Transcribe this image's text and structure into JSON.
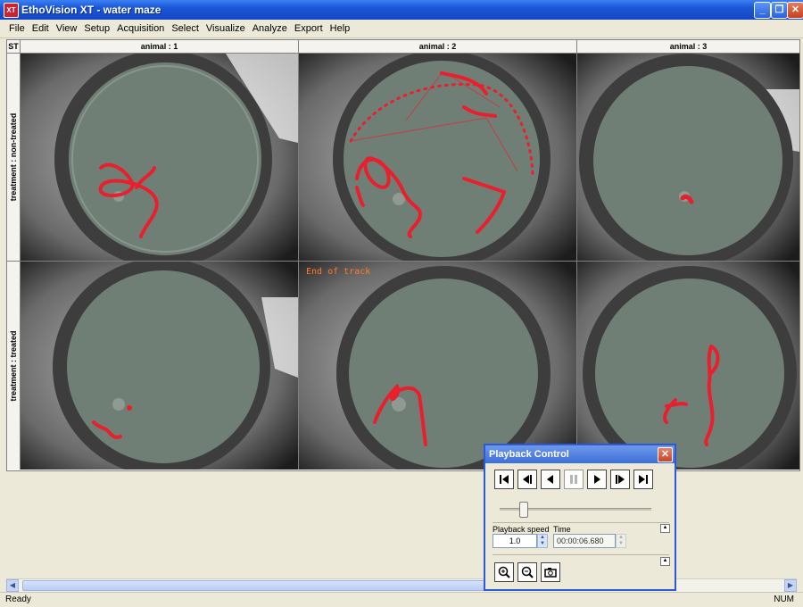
{
  "window": {
    "title": "EthoVision XT - water maze",
    "app_icon": "XT"
  },
  "window_controls": [
    "_",
    "❐",
    "✕"
  ],
  "menu": [
    "File",
    "Edit",
    "View",
    "Setup",
    "Acquisition",
    "Select",
    "Visualize",
    "Analyze",
    "Export",
    "Help"
  ],
  "grid": {
    "corner": "ST",
    "columns": [
      "animal : 1",
      "animal : 2",
      "animal : 3"
    ],
    "rows": [
      "treatment : non-treated",
      "treatment : treated"
    ],
    "end_of_track": "End of track"
  },
  "colors": {
    "track": "#e8202e",
    "arena": "#6f7f76"
  },
  "playback": {
    "title": "Playback Control",
    "close": "✕",
    "speed_label": "Playback speed",
    "speed_value": "1.0",
    "time_label": "Time",
    "time_value": "00:00:06.680",
    "collapse": "▲",
    "slider_position": 0.15
  },
  "status": {
    "left": "Ready",
    "right": "NUM"
  }
}
